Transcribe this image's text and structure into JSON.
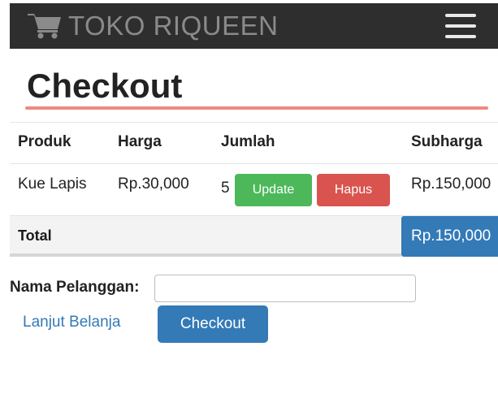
{
  "navbar": {
    "brand_icon": "shopping-cart-icon",
    "brand": "TOKO RIQUEEN",
    "menu_icon": "hamburger-menu-icon"
  },
  "page": {
    "title": "Checkout"
  },
  "cart": {
    "headers": [
      "Produk",
      "Harga",
      "Jumlah",
      "Subharga"
    ],
    "rows": [
      {
        "product": "Kue Lapis",
        "price": "Rp.30,000",
        "quantity": "5",
        "update_label": "Update",
        "delete_label": "Hapus",
        "subtotal": "Rp.150,000"
      }
    ],
    "total_label": "Total",
    "total_value": "Rp.150,000"
  },
  "form": {
    "name_label": "Nama Pelanggan:",
    "name_value": "",
    "continue_link": "Lanjut Belanja",
    "checkout_button": "Checkout"
  },
  "colors": {
    "navbar_bg": "#2e2e2e",
    "accent_rule": "#ef8a7f",
    "primary": "#337ab7",
    "success": "#4cb85a",
    "danger": "#d9534f"
  }
}
